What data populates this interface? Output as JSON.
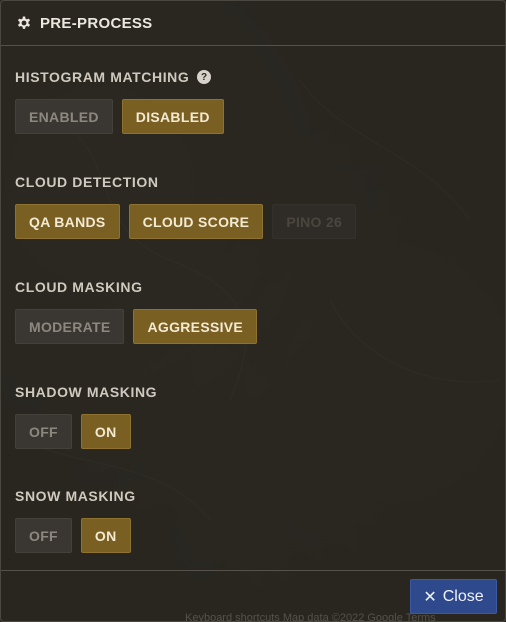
{
  "header": {
    "title": "PRE-PROCESS",
    "icon": "gear-icon"
  },
  "sections": {
    "histogram": {
      "label": "HISTOGRAM MATCHING",
      "help_icon": "?",
      "options": [
        {
          "label": "ENABLED",
          "state": "off"
        },
        {
          "label": "DISABLED",
          "state": "on"
        }
      ]
    },
    "cloud_detection": {
      "label": "CLOUD DETECTION",
      "options": [
        {
          "label": "QA BANDS",
          "state": "on"
        },
        {
          "label": "CLOUD SCORE",
          "state": "on"
        },
        {
          "label": "PINO 26",
          "state": "disabled"
        }
      ]
    },
    "cloud_masking": {
      "label": "CLOUD MASKING",
      "options": [
        {
          "label": "MODERATE",
          "state": "off"
        },
        {
          "label": "AGGRESSIVE",
          "state": "on"
        }
      ]
    },
    "shadow_masking": {
      "label": "SHADOW MASKING",
      "options": [
        {
          "label": "OFF",
          "state": "off"
        },
        {
          "label": "ON",
          "state": "on"
        }
      ]
    },
    "snow_masking": {
      "label": "SNOW MASKING",
      "options": [
        {
          "label": "OFF",
          "state": "off"
        },
        {
          "label": "ON",
          "state": "on"
        }
      ]
    }
  },
  "footer": {
    "close_label": "Close",
    "close_icon": "close-icon",
    "attribution": "Keyboard shortcuts   Map data ©2022 Google   Terms"
  },
  "colors": {
    "selected": "#7a5f22",
    "unselected": "#3a3732",
    "close_button": "#2e4a8c"
  }
}
